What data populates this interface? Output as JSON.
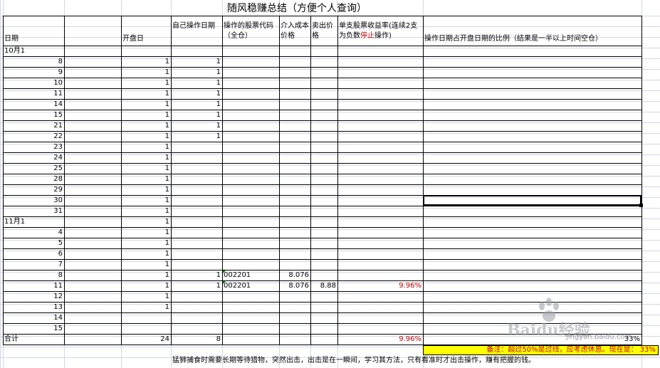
{
  "title": "随风稳赚总结（方便个人查询）",
  "headers": {
    "date": "日期",
    "open_day": "开盘日",
    "own_op_day": "自己操作日期",
    "stock_code": "操作的股票代码（全仓）",
    "entry_cost": "介入成本价格",
    "sell_price": "卖出价格",
    "return_rate_pre": "单支股票收益率(连续2支为负数",
    "return_rate_stop": "停止",
    "return_rate_post": "操作)",
    "ratio": "操作日期占开盘日期的比例（结果是一半以上时间空仓）"
  },
  "month_labels": [
    "10月1",
    "11月1"
  ],
  "rows": [
    {
      "date": "10月1",
      "open": "",
      "own": "",
      "code": "",
      "cost": "",
      "sell": "",
      "rate": ""
    },
    {
      "date": "8",
      "open": "1",
      "own": "1",
      "code": "",
      "cost": "",
      "sell": "",
      "rate": ""
    },
    {
      "date": "9",
      "open": "1",
      "own": "1",
      "code": "",
      "cost": "",
      "sell": "",
      "rate": ""
    },
    {
      "date": "10",
      "open": "1",
      "own": "1",
      "code": "",
      "cost": "",
      "sell": "",
      "rate": ""
    },
    {
      "date": "11",
      "open": "1",
      "own": "1",
      "code": "",
      "cost": "",
      "sell": "",
      "rate": ""
    },
    {
      "date": "14",
      "open": "1",
      "own": "1",
      "code": "",
      "cost": "",
      "sell": "",
      "rate": ""
    },
    {
      "date": "15",
      "open": "1",
      "own": "1",
      "code": "",
      "cost": "",
      "sell": "",
      "rate": ""
    },
    {
      "date": "21",
      "open": "1",
      "own": "1",
      "code": "",
      "cost": "",
      "sell": "",
      "rate": ""
    },
    {
      "date": "22",
      "open": "1",
      "own": "1",
      "code": "",
      "cost": "",
      "sell": "",
      "rate": ""
    },
    {
      "date": "23",
      "open": "1",
      "own": "",
      "code": "",
      "cost": "",
      "sell": "",
      "rate": ""
    },
    {
      "date": "24",
      "open": "1",
      "own": "",
      "code": "",
      "cost": "",
      "sell": "",
      "rate": ""
    },
    {
      "date": "25",
      "open": "1",
      "own": "",
      "code": "",
      "cost": "",
      "sell": "",
      "rate": ""
    },
    {
      "date": "28",
      "open": "1",
      "own": "",
      "code": "",
      "cost": "",
      "sell": "",
      "rate": ""
    },
    {
      "date": "29",
      "open": "1",
      "own": "",
      "code": "",
      "cost": "",
      "sell": "",
      "rate": ""
    },
    {
      "date": "30",
      "open": "1",
      "own": "",
      "code": "",
      "cost": "",
      "sell": "",
      "rate": ""
    },
    {
      "date": "31",
      "open": "1",
      "own": "",
      "code": "",
      "cost": "",
      "sell": "",
      "rate": ""
    },
    {
      "date": "11月1",
      "open": "1",
      "own": "",
      "code": "",
      "cost": "",
      "sell": "",
      "rate": ""
    },
    {
      "date": "4",
      "open": "1",
      "own": "",
      "code": "",
      "cost": "",
      "sell": "",
      "rate": ""
    },
    {
      "date": "5",
      "open": "1",
      "own": "",
      "code": "",
      "cost": "",
      "sell": "",
      "rate": ""
    },
    {
      "date": "6",
      "open": "1",
      "own": "",
      "code": "",
      "cost": "",
      "sell": "",
      "rate": ""
    },
    {
      "date": "7",
      "open": "1",
      "own": "",
      "code": "",
      "cost": "",
      "sell": "",
      "rate": ""
    },
    {
      "date": "8",
      "open": "1",
      "own": "1",
      "code": "002201",
      "cost": "8.076",
      "sell": "",
      "rate": ""
    },
    {
      "date": "11",
      "open": "1",
      "own": "1",
      "code": "002201",
      "cost": "8.076",
      "sell": "8.88",
      "rate": "9.96%"
    },
    {
      "date": "12",
      "open": "1",
      "own": "",
      "code": "",
      "cost": "",
      "sell": "",
      "rate": ""
    },
    {
      "date": "13",
      "open": "1",
      "own": "",
      "code": "",
      "cost": "",
      "sell": "",
      "rate": ""
    },
    {
      "date": "14",
      "open": "",
      "own": "",
      "code": "",
      "cost": "",
      "sell": "",
      "rate": ""
    },
    {
      "date": "15",
      "open": "",
      "own": "",
      "code": "",
      "cost": "",
      "sell": "",
      "rate": ""
    }
  ],
  "total": {
    "label": "合计",
    "open": "24",
    "own": "8",
    "rate": "9.96%",
    "ratio": "33%"
  },
  "note": "备注：超过50%是过线，应考虑休息。现在是： 33%",
  "footer": "猛狮捕食时需要长期等待猎物，突然出击，出击是在一瞬间，学习其方法，只有看准时才出击操作，赚有把握的钱。",
  "watermark": {
    "brand": "Baidu经验",
    "url": "jingyan.baidu.com"
  },
  "colors": {
    "grid": "#d0d7e5",
    "border": "#000000",
    "note_bg": "#ffff00",
    "accent_red": "#c00000"
  }
}
